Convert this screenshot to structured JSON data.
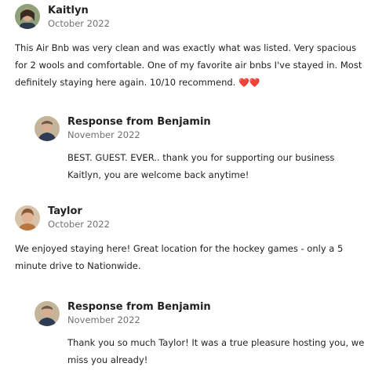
{
  "reviews": [
    {
      "author": "Kaitlyn",
      "date": "October 2022",
      "text": "This Air Bnb was very clean and was exactly what was listed. Very spacious for 2 wools and comfortable. One of my favorite air bnbs I've stayed in. Most definitely staying here again. 10/10 recommend.",
      "emoji": "❤️❤️",
      "response": {
        "author": "Response from Benjamin",
        "date": "November 2022",
        "text": "BEST. GUEST. EVER.. thank you for supporting our business Kaitlyn, you are welcome back anytime!"
      }
    },
    {
      "author": "Taylor",
      "date": "October 2022",
      "text": "We enjoyed staying here! Great location for the hockey games - only a 5 minute drive to Nationwide.",
      "response": {
        "author": "Response from Benjamin",
        "date": "November 2022",
        "text": "Thank you so much Taylor! It was a true pleasure hosting you, we miss you already!"
      }
    }
  ]
}
